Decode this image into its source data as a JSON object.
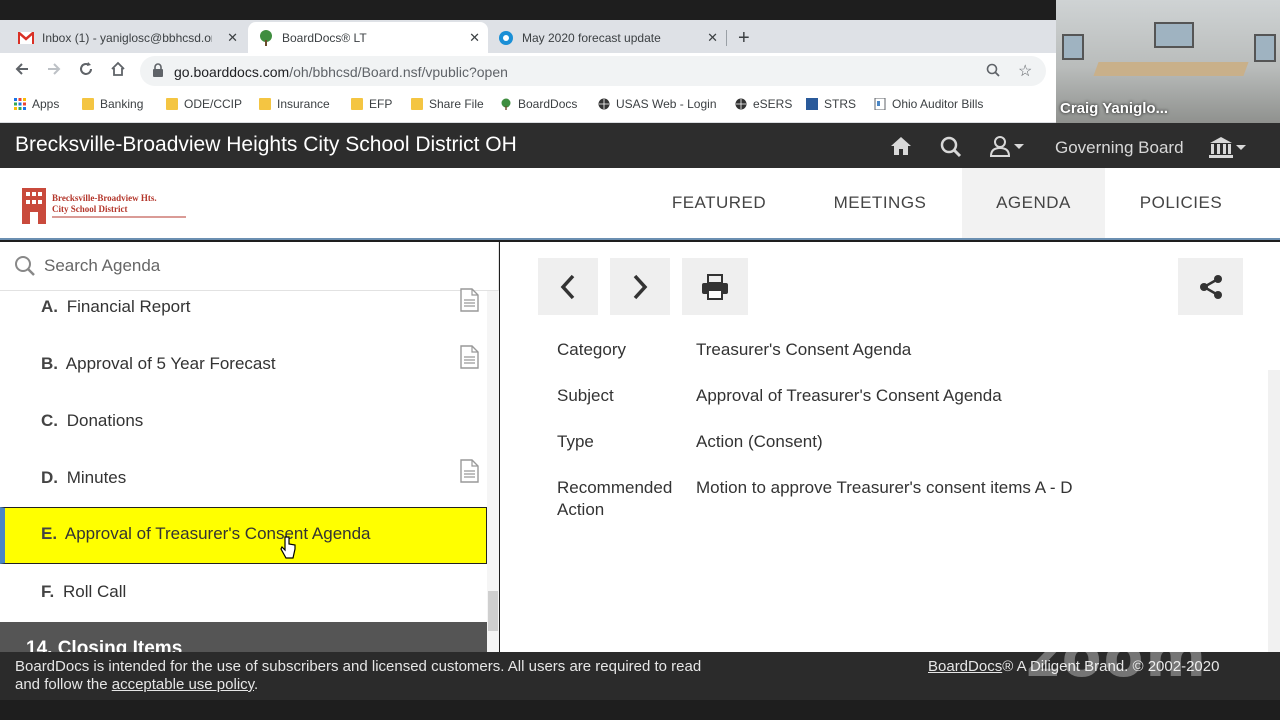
{
  "browser": {
    "tabs": [
      {
        "title": "Inbox (1) - yaniglosc@bbhcsd.or",
        "active": false
      },
      {
        "title": "BoardDocs® LT",
        "active": true
      },
      {
        "title": "May 2020 forecast update",
        "active": false
      }
    ],
    "url_host": "go.boarddocs.com",
    "url_path": "/oh/bbhcsd/Board.nsf/vpublic?open",
    "bookmarks": [
      "Apps",
      "Banking",
      "ODE/CCIP",
      "Insurance",
      "EFP",
      "Share File",
      "BoardDocs",
      "USAS Web - Login",
      "eSERS",
      "STRS",
      "Ohio Auditor Bills"
    ]
  },
  "video": {
    "participant_name": "Craig Yaniglo..."
  },
  "header": {
    "title": "Brecksville-Broadview Heights City School District OH",
    "governing_board": "Governing Board"
  },
  "logo": {
    "line1": "Brecksville-Broadview Hts.",
    "line2": "City School District"
  },
  "nav": {
    "items": [
      "FEATURED",
      "MEETINGS",
      "AGENDA",
      "POLICIES"
    ],
    "active": "AGENDA"
  },
  "search": {
    "placeholder": "Search Agenda"
  },
  "agenda": {
    "items": [
      {
        "letter": "A.",
        "label": "Financial Report",
        "has_doc": true
      },
      {
        "letter": "B.",
        "label": "Approval of 5 Year Forecast",
        "has_doc": true
      },
      {
        "letter": "C.",
        "label": "Donations",
        "has_doc": false
      },
      {
        "letter": "D.",
        "label": "Minutes",
        "has_doc": true
      },
      {
        "letter": "E.",
        "label": "Approval of Treasurer's Consent Agenda",
        "has_doc": false,
        "selected": true
      },
      {
        "letter": "F.",
        "label": "Roll Call",
        "has_doc": false
      }
    ],
    "section": "14. Closing Items"
  },
  "detail": {
    "category_label": "Category",
    "category": "Treasurer's Consent Agenda",
    "subject_label": "Subject",
    "subject": "Approval of Treasurer's Consent Agenda",
    "type_label": "Type",
    "type": "Action (Consent)",
    "recommended_label_1": "Recommended",
    "recommended_label_2": "Action",
    "recommended": "Motion to approve Treasurer's consent items A - D"
  },
  "footer": {
    "notice": "BoardDocs is intended for the use of subscribers and licensed customers. All users are required to read",
    "notice2_pre": "and follow the ",
    "policy_link": "acceptable use policy",
    "notice2_post": ".",
    "brand_link": "BoardDocs",
    "brand_rest": "® A Diligent Brand. © 2002-2020"
  },
  "watermark": "zoom",
  "colors": {
    "selected_bg": "#ffff00",
    "accent": "#4a86c5",
    "header_bg": "#2d2d2d"
  }
}
